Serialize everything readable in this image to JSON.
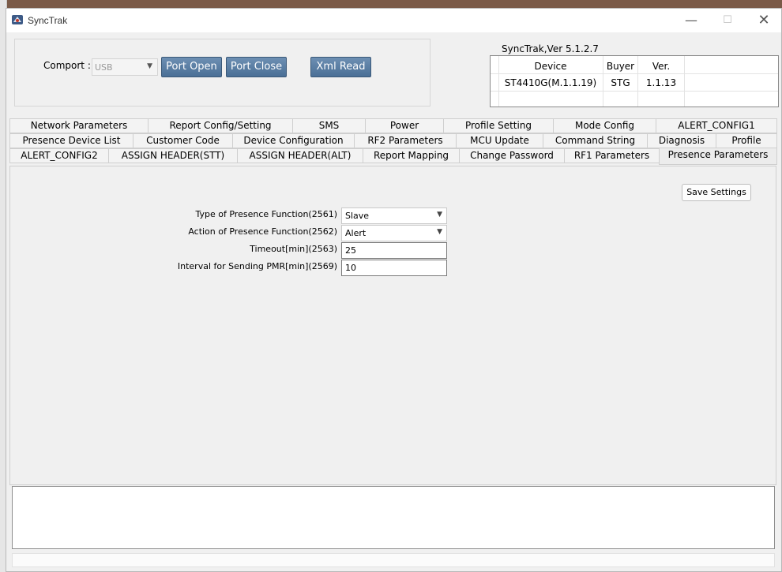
{
  "window": {
    "title": "SyncTrak",
    "min": "—",
    "max": "☐",
    "close": "✕"
  },
  "port": {
    "label": "Comport :",
    "comport_value": "USB",
    "open_label": "Port Open",
    "close_label": "Port Close",
    "xml_label": "Xml Read"
  },
  "version_label": "SyncTrak,Ver 5.1.2.7",
  "device_table": {
    "headers": [
      "Device",
      "Buyer",
      "Ver."
    ],
    "row": [
      "ST4410G(M.1.1.19)",
      "STG",
      "1.1.13"
    ]
  },
  "tabs": {
    "row1": [
      "Network Parameters",
      "Report Config/Setting",
      "SMS",
      "Power",
      "Profile Setting",
      "Mode Config",
      "ALERT_CONFIG1"
    ],
    "row2": [
      "Presence Device List",
      "Customer Code",
      "Device Configuration",
      "RF2 Parameters",
      "MCU Update",
      "Command String",
      "Diagnosis",
      "Profile"
    ],
    "row3": [
      "ALERT_CONFIG2",
      "ASSIGN HEADER(STT)",
      "ASSIGN HEADER(ALT)",
      "Report Mapping",
      "Change Password",
      "RF1 Parameters",
      "Presence Parameters"
    ],
    "active": "Presence Parameters"
  },
  "presence": {
    "save_label": "Save Settings",
    "fields": [
      {
        "label": "Type of Presence Function(2561)",
        "value": "Slave"
      },
      {
        "label": "Action of Presence Function(2562)",
        "value": "Alert"
      },
      {
        "label": "Timeout[min](2563)",
        "value": "25"
      },
      {
        "label": "Interval for Sending PMR[min](2569)",
        "value": "10"
      }
    ]
  },
  "colors": {
    "button_blue": "#4a6f96",
    "button_border": "#3a5878"
  },
  "icons": {
    "app": "synctrak-logo-icon",
    "dropdown": "chevron-down-icon"
  }
}
